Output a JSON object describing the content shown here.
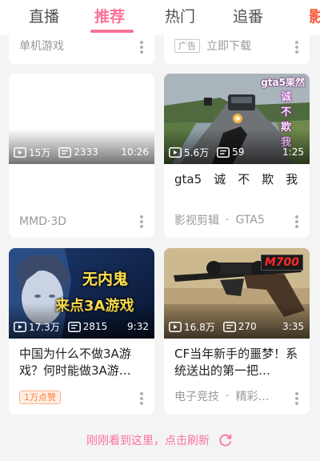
{
  "tabs": [
    {
      "label": "直播"
    },
    {
      "label": "推荐"
    },
    {
      "label": "热门"
    },
    {
      "label": "追番"
    },
    {
      "label": "影"
    }
  ],
  "top_row": {
    "left": {
      "meta": "单机游戏"
    },
    "right": {
      "ad_label": "广告",
      "meta": "立即下载"
    }
  },
  "cards": [
    {
      "views": "15万",
      "danmaku": "2333",
      "duration": "10:26",
      "title": "",
      "meta": "MMD·3D"
    },
    {
      "views": "5.6万",
      "danmaku": "59",
      "duration": "1:25",
      "overlay_title": "gta5果然",
      "overlay_chars": [
        "诚",
        "不",
        "欺",
        "我"
      ],
      "title": "gta5　诚　不　欺　我",
      "meta_left": "影视剪辑",
      "meta_sep": "·",
      "meta_right": "GTA5"
    },
    {
      "views": "17.3万",
      "danmaku": "2815",
      "duration": "9:32",
      "overlay_line1": "无内鬼",
      "overlay_line2": "来点3A游戏",
      "title": "中国为什么不做3A游戏？何时能做3A游…",
      "badge": "1万点赞"
    },
    {
      "views": "16.8万",
      "danmaku": "270",
      "duration": "3:35",
      "overlay_tag": "M700",
      "title": "CF当年新手的噩梦！系统送出的第一把…",
      "meta_left": "电子竞技",
      "meta_sep": "·",
      "meta_right": "精彩…"
    }
  ],
  "footer": {
    "label": "刚刚看到这里，点击刷新"
  },
  "colors": {
    "accent": "#fb7299",
    "background": "#f4f4f4",
    "card": "#ffffff"
  }
}
